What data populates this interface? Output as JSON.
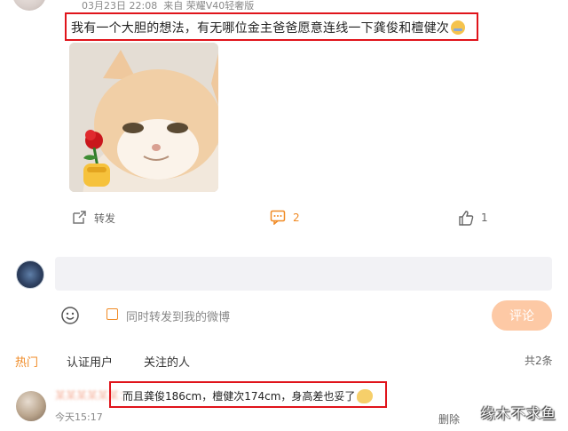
{
  "post": {
    "meta_date": "03月23日 22:08",
    "meta_source": "来自 荣耀V40轻奢版",
    "text": "我有一个大胆的想法，有无哪位金主爸爸愿意连线一下龚俊和檀健次",
    "text_emoji": "face-palm-emoji"
  },
  "actions": {
    "repost_label": "转发",
    "comment_count": "2",
    "like_count": "1"
  },
  "composer": {
    "input_value": "",
    "repost_checkbox_label": "同时转发到我的微博",
    "repost_checked": false,
    "submit_label": "评论"
  },
  "comment_tabs": {
    "hot": "热门",
    "verified": "认证用户",
    "following": "关注的人",
    "active": "hot",
    "total": "共2条"
  },
  "comment": {
    "author": "某某某某某某：",
    "text": "而且龚俊186cm，檀健次174cm，身高差也妥了",
    "emoji": "thumbs-emoji",
    "time": "今天15:17",
    "delete_label": "删除"
  },
  "watermark": "缘木不求鱼",
  "colors": {
    "accent": "#f08a24",
    "highlight_border": "#e0141b",
    "submit_disabled": "#fdc9a5"
  }
}
